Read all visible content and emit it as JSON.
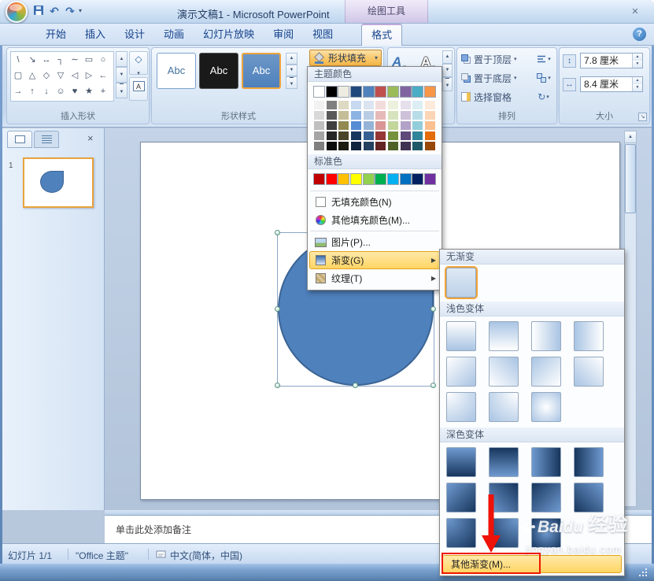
{
  "window": {
    "title": "演示文稿1 - Microsoft PowerPoint",
    "contextual_tool_header": "绘图工具"
  },
  "icons": {
    "close": "✕",
    "help": "?",
    "undo": "↶",
    "redo": "↷",
    "dropdown": "▾",
    "submenu_arrow": "▶",
    "scroll_up": "▲",
    "scroll_down": "▼",
    "spin_up": "▲",
    "spin_down": "▼",
    "height": "↕",
    "width": "↔",
    "rotate": "↻",
    "edit_shape": "◇",
    "text_box": "A",
    "wordart_fill": "A",
    "wordart_outline": "A",
    "launcher": "↘",
    "pane_close": "×"
  },
  "tabs": [
    {
      "label": "开始"
    },
    {
      "label": "插入"
    },
    {
      "label": "设计"
    },
    {
      "label": "动画"
    },
    {
      "label": "幻灯片放映"
    },
    {
      "label": "审阅"
    },
    {
      "label": "视图"
    },
    {
      "label": "格式"
    }
  ],
  "ribbon": {
    "insert_shapes": {
      "label": "插入形状",
      "shapes": [
        {
          "name": "line",
          "glyph": "\\"
        },
        {
          "name": "arrow",
          "glyph": "↘"
        },
        {
          "name": "double-arrow",
          "glyph": "↔"
        },
        {
          "name": "elbow-connector",
          "glyph": "┐"
        },
        {
          "name": "curve",
          "glyph": "∼"
        },
        {
          "name": "rectangle",
          "glyph": "▭"
        },
        {
          "name": "oval",
          "glyph": "○"
        },
        {
          "name": "rounded-rectangle",
          "glyph": "▢"
        },
        {
          "name": "triangle",
          "glyph": "△"
        },
        {
          "name": "diamond",
          "glyph": "◇"
        },
        {
          "name": "down-triangle",
          "glyph": "▽"
        },
        {
          "name": "left-triangle",
          "glyph": "◁"
        },
        {
          "name": "right-triangle",
          "glyph": "▷"
        },
        {
          "name": "left-arrow",
          "glyph": "←"
        },
        {
          "name": "right-arrow",
          "glyph": "→"
        },
        {
          "name": "up-arrow",
          "glyph": "↑"
        },
        {
          "name": "down-arrow",
          "glyph": "↓"
        },
        {
          "name": "smiley",
          "glyph": "☺"
        },
        {
          "name": "heart",
          "glyph": "♥"
        },
        {
          "name": "star",
          "glyph": "★"
        },
        {
          "name": "plus",
          "glyph": "+"
        }
      ]
    },
    "shape_styles": {
      "label": "形状样式",
      "previews": [
        {
          "label": "Abc"
        },
        {
          "label": "Abc"
        },
        {
          "label": "Abc"
        }
      ],
      "fill_button_label": "形状填充"
    },
    "arrange": {
      "label": "排列",
      "bring_to_front": "置于顶层",
      "send_to_back": "置于底层",
      "selection_pane": "选择窗格"
    },
    "size": {
      "label": "大小",
      "height_value": "7.8 厘米",
      "width_value": "8.4 厘米"
    }
  },
  "fill_menu": {
    "theme_colors_label": "主题颜色",
    "standard_colors_label": "标准色",
    "theme_colors": [
      [
        "#FFFFFF",
        "#F2F2F2",
        "#D8D8D8",
        "#BFBFBF",
        "#A5A5A5",
        "#7F7F7F"
      ],
      [
        "#000000",
        "#7F7F7F",
        "#595959",
        "#3F3F3F",
        "#262626",
        "#0C0C0C"
      ],
      [
        "#EEECE1",
        "#DDD9C3",
        "#C4BD97",
        "#938953",
        "#494429",
        "#1D1B10"
      ],
      [
        "#1F497D",
        "#C6D9F0",
        "#8DB3E2",
        "#548DD4",
        "#17365D",
        "#0F243E"
      ],
      [
        "#4F81BD",
        "#DBE5F1",
        "#B8CCE4",
        "#95B3D7",
        "#366092",
        "#244061"
      ],
      [
        "#C0504D",
        "#F2DCDB",
        "#E5B9B7",
        "#D99694",
        "#953734",
        "#632423"
      ],
      [
        "#9BBB59",
        "#EBF1DD",
        "#D7E3BC",
        "#C3D69B",
        "#76923C",
        "#4F6128"
      ],
      [
        "#8064A2",
        "#E5E0EC",
        "#CCC1D9",
        "#B2A2C7",
        "#5F497A",
        "#3F3151"
      ],
      [
        "#4BACC6",
        "#DBEEF3",
        "#B7DDE8",
        "#92CDDC",
        "#31859B",
        "#205867"
      ],
      [
        "#F79646",
        "#FDEADA",
        "#FBD5B5",
        "#FAC08F",
        "#E36C09",
        "#974806"
      ]
    ],
    "standard_colors": [
      "#C00000",
      "#FF0000",
      "#FFC000",
      "#FFFF00",
      "#92D050",
      "#00B050",
      "#00B0F0",
      "#0070C0",
      "#002060",
      "#7030A0"
    ],
    "items": [
      {
        "label": "无填充颜色(N)"
      },
      {
        "label": "其他填充颜色(M)..."
      },
      {
        "label": "图片(P)..."
      },
      {
        "label": "渐变(G)"
      },
      {
        "label": "纹理(T)"
      }
    ]
  },
  "gradient_submenu": {
    "no_gradient_label": "无渐变",
    "light_label": "浅色变体",
    "dark_label": "深色变体",
    "more_label": "其他渐变(M)...",
    "no_gradient_swatch": "linear-gradient(180deg,#dfe9f5,#bcd1e8)",
    "light_variants": [
      "linear-gradient(180deg,#ffffff,#a9c4e3)",
      "linear-gradient(0deg,#ffffff,#a9c4e3)",
      "linear-gradient(90deg,#ffffff,#a9c4e3)",
      "linear-gradient(270deg,#ffffff,#a9c4e3)",
      "linear-gradient(135deg,#ffffff,#a9c4e3)",
      "linear-gradient(45deg,#ffffff,#a9c4e3)",
      "linear-gradient(315deg,#ffffff,#a9c4e3)",
      "linear-gradient(225deg,#ffffff,#a9c4e3)",
      "radial-gradient(circle at 0% 0%,#ffffff,#a9c4e3)",
      "radial-gradient(circle at 100% 0%,#ffffff,#a9c4e3)",
      "radial-gradient(circle at 50% 50%,#ffffff,#a9c4e3)"
    ],
    "dark_variants": [
      "linear-gradient(180deg,#6f9ad0,#17365d)",
      "linear-gradient(0deg,#6f9ad0,#17365d)",
      "linear-gradient(90deg,#6f9ad0,#17365d)",
      "linear-gradient(270deg,#6f9ad0,#17365d)",
      "linear-gradient(135deg,#6f9ad0,#17365d)",
      "linear-gradient(45deg,#6f9ad0,#17365d)",
      "linear-gradient(315deg,#6f9ad0,#17365d)",
      "linear-gradient(225deg,#6f9ad0,#17365d)",
      "radial-gradient(circle at 0% 0%,#6f9ad0,#17365d)",
      "radial-gradient(circle at 100% 0%,#6f9ad0,#17365d)",
      "radial-gradient(circle at 50% 50%,#6f9ad0,#17365d)"
    ]
  },
  "slides_panel": {
    "slide_number": "1"
  },
  "slide": {
    "shape": {
      "type": "teardrop",
      "fill": "#4f81bd",
      "border": "#3c6494"
    }
  },
  "notes": {
    "placeholder": "单击此处添加备注"
  },
  "status_bar": {
    "slide_indicator": "幻灯片 1/1",
    "theme_name": "\"Office 主题\"",
    "language": "中文(简体，中国)"
  },
  "watermark": {
    "brand": "Baidu",
    "suffix": "经验",
    "url": "jingyan.baidu.com"
  }
}
